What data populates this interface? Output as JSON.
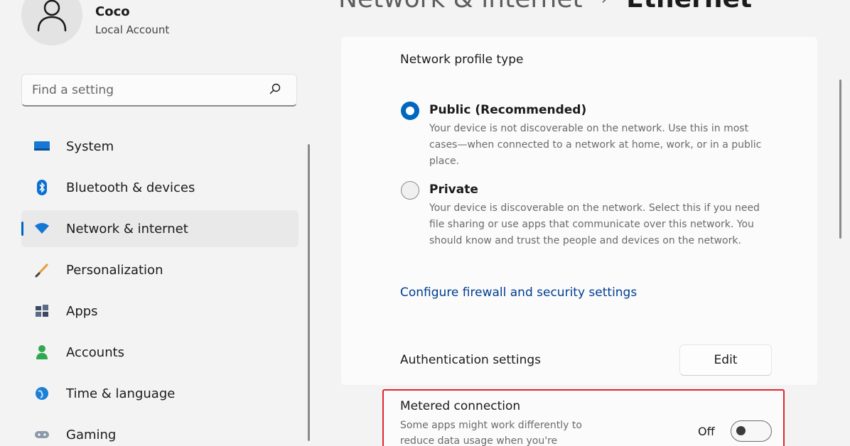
{
  "user": {
    "name": "Coco",
    "account_type": "Local Account",
    "avatar_icon": "person-icon"
  },
  "search": {
    "placeholder": "Find a setting",
    "icon": "search-icon"
  },
  "nav": {
    "selected": "Network & internet",
    "items": [
      {
        "label": "System",
        "icon": "monitor-icon"
      },
      {
        "label": "Bluetooth & devices",
        "icon": "bluetooth-icon"
      },
      {
        "label": "Network & internet",
        "icon": "wifi-icon"
      },
      {
        "label": "Personalization",
        "icon": "brush-icon"
      },
      {
        "label": "Apps",
        "icon": "apps-icon"
      },
      {
        "label": "Accounts",
        "icon": "person-icon"
      },
      {
        "label": "Time & language",
        "icon": "globe-clock-icon"
      },
      {
        "label": "Gaming",
        "icon": "gamepad-icon"
      }
    ]
  },
  "header": {
    "parent": "Network & internet",
    "separator": "›",
    "current": "Ethernet"
  },
  "profile": {
    "title": "Network profile type",
    "options": [
      {
        "label": "Public (Recommended)",
        "checked": true,
        "description": "Your device is not discoverable on the network. Use this in most cases—when connected to a network at home, work, or in a public place."
      },
      {
        "label": "Private",
        "checked": false,
        "description": "Your device is discoverable on the network. Select this if you need file sharing or use apps that communicate over this network. You should know and trust the people and devices on the network."
      }
    ],
    "firewall_link": "Configure firewall and security settings"
  },
  "authentication": {
    "label": "Authentication settings",
    "button": "Edit"
  },
  "metered": {
    "title": "Metered connection",
    "description": "Some apps might work differently to reduce data usage when you're",
    "state_label": "Off",
    "on": false
  },
  "colors": {
    "accent": "#0067c0",
    "link": "#003e92",
    "highlight_box": "#e0262f",
    "background": "#f3f3f3",
    "card": "#fbfbfb"
  }
}
